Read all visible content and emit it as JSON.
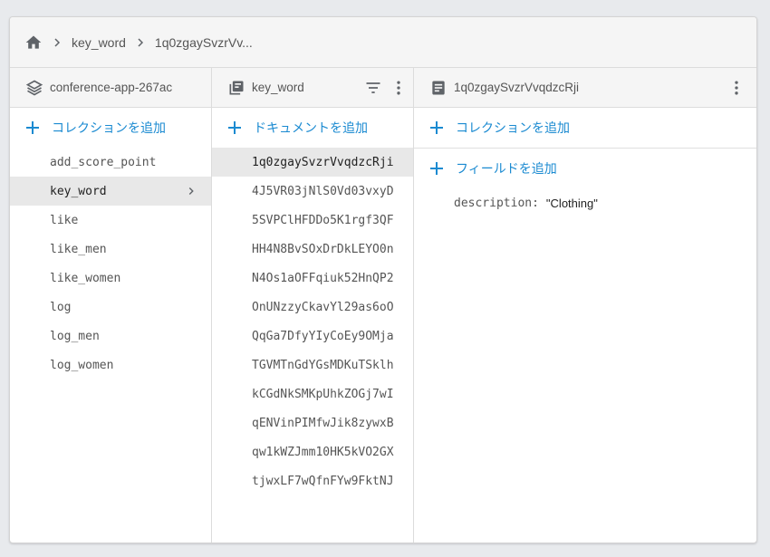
{
  "breadcrumb": {
    "items": [
      "key_word",
      "1q0zgaySvzrVv..."
    ]
  },
  "columns": {
    "root": {
      "title": "conference-app-267ac",
      "add_label": "コレクションを追加",
      "items": [
        "add_score_point",
        "key_word",
        "like",
        "like_men",
        "like_women",
        "log",
        "log_men",
        "log_women"
      ],
      "selected": "key_word"
    },
    "collection": {
      "title": "key_word",
      "add_label": "ドキュメントを追加",
      "items": [
        "1q0zgaySvzrVvqdzcRji",
        "4J5VR03jNlS0Vd03vxyD",
        "5SVPClHFDDo5K1rgf3QF",
        "HH4N8BvSOxDrDkLEYO0n",
        "N4Os1aOFFqiuk52HnQP2",
        "OnUNzzyCkavYl29as6oO",
        "QqGa7DfyYIyCoEy9OMja",
        "TGVMTnGdYGsMDKuTSklh",
        "kCGdNkSMKpUhkZOGj7wI",
        "qENVinPIMfwJik8zywxB",
        "qw1kWZJmm10HK5kVO2GX",
        "tjwxLF7wQfnFYw9FktNJ"
      ],
      "selected": "1q0zgaySvzrVvqdzcRji"
    },
    "document": {
      "title": "1q0zgaySvzrVvqdzcRji",
      "add_collection_label": "コレクションを追加",
      "add_field_label": "フィールドを追加",
      "fields": [
        {
          "key": "description:",
          "value": "\"Clothing\""
        }
      ]
    }
  },
  "colors": {
    "accent": "#1a8ad1",
    "selected_bg": "#e8e8e8",
    "header_bg": "#f5f5f5"
  }
}
